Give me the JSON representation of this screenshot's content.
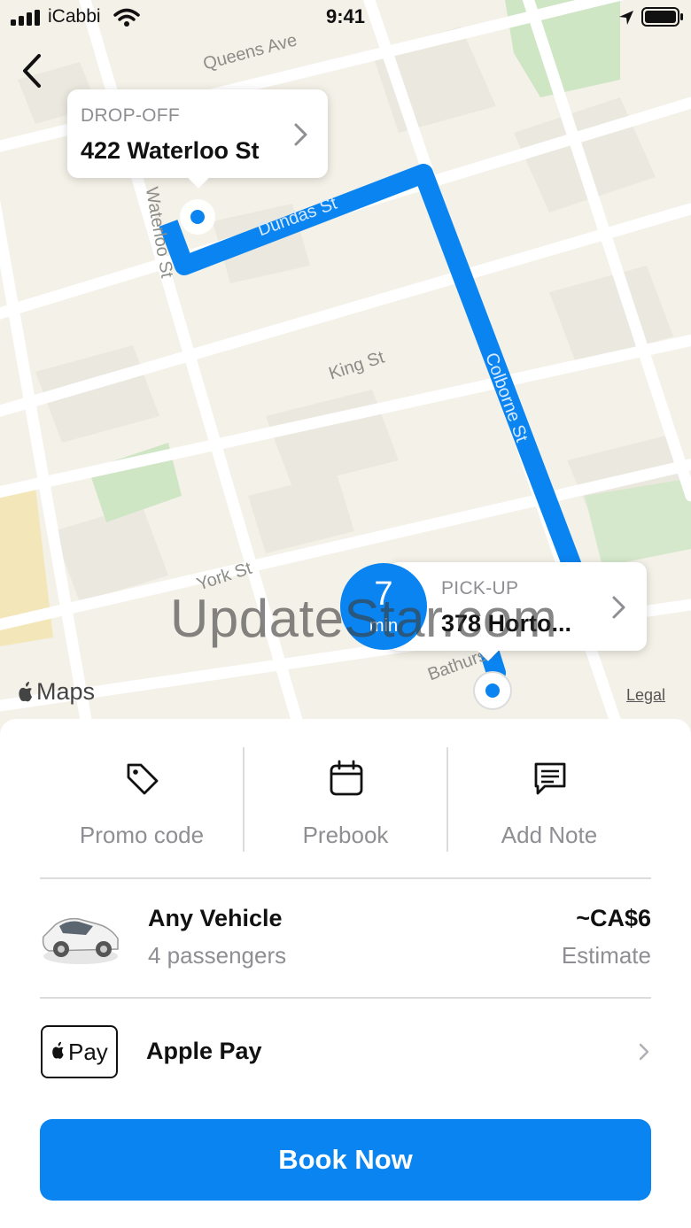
{
  "status_bar": {
    "carrier": "iCabbi",
    "time": "9:41"
  },
  "map": {
    "streets": [
      "Queens Ave",
      "Dundas St",
      "King St",
      "Colborne St",
      "York St",
      "Bathurst",
      "Waterloo St"
    ],
    "brand": "Maps",
    "legal": "Legal",
    "watermark": "UpdateStar.com",
    "route_color": "#0a84f0"
  },
  "dropoff": {
    "title": "DROP-OFF",
    "address": "422 Waterloo St"
  },
  "pickup": {
    "title": "PICK-UP",
    "address": "378 Horto..."
  },
  "eta": {
    "value": "7",
    "unit": "min"
  },
  "actions": [
    {
      "label": "Promo code",
      "icon": "tag-icon"
    },
    {
      "label": "Prebook",
      "icon": "calendar-icon"
    },
    {
      "label": "Add Note",
      "icon": "note-icon"
    }
  ],
  "vehicle": {
    "name": "Any Vehicle",
    "capacity": "4 passengers",
    "price": "~CA$6",
    "price_note": "Estimate"
  },
  "payment": {
    "badge_text": "Pay",
    "method": "Apple Pay"
  },
  "book_button": {
    "label": "Book Now"
  }
}
